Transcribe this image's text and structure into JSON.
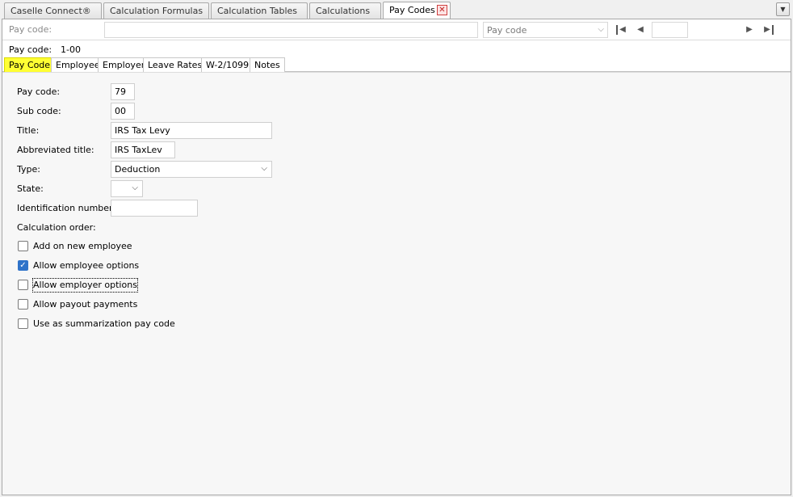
{
  "doc_tabs": [
    {
      "label": "Caselle Connect®"
    },
    {
      "label": "Calculation Formulas"
    },
    {
      "label": "Calculation Tables"
    },
    {
      "label": "Calculations"
    },
    {
      "label": "Pay Codes",
      "active": true
    }
  ],
  "icons": {
    "close": "close-icon",
    "menu": "chevron-down-icon"
  },
  "toolbar": {
    "label": "Pay code:",
    "input_value": "",
    "select_value": "Pay code",
    "page_value": ""
  },
  "info": {
    "label": "Pay code:",
    "value": "1-00"
  },
  "section_tabs": [
    {
      "label": "Pay Code",
      "active": true
    },
    {
      "label": "Employee"
    },
    {
      "label": "Employer"
    },
    {
      "label": "Leave Rates"
    },
    {
      "label": "W-2/1099"
    },
    {
      "label": "Notes"
    }
  ],
  "form": {
    "pay_code": {
      "label": "Pay code:",
      "value": "79"
    },
    "sub_code": {
      "label": "Sub code:",
      "value": "00"
    },
    "title": {
      "label": "Title:",
      "value": "IRS Tax Levy"
    },
    "abbreviated_title": {
      "label": "Abbreviated title:",
      "value": "IRS TaxLev"
    },
    "type": {
      "label": "Type:",
      "value": "Deduction"
    },
    "state": {
      "label": "State:",
      "value": ""
    },
    "identification_number": {
      "label": "Identification number:",
      "value": ""
    },
    "calculation_order": {
      "label": "Calculation order:"
    }
  },
  "checkboxes": [
    {
      "label": "Add on new employee",
      "checked": false
    },
    {
      "label": "Allow employee options",
      "checked": true
    },
    {
      "label": "Allow employer options",
      "checked": false,
      "focused": true
    },
    {
      "label": "Allow payout payments",
      "checked": false
    },
    {
      "label": "Use as summarization pay code",
      "checked": false
    }
  ],
  "colors": {
    "active_section_tab": "#ffff33",
    "checkbox_checked": "#2f73c9"
  }
}
